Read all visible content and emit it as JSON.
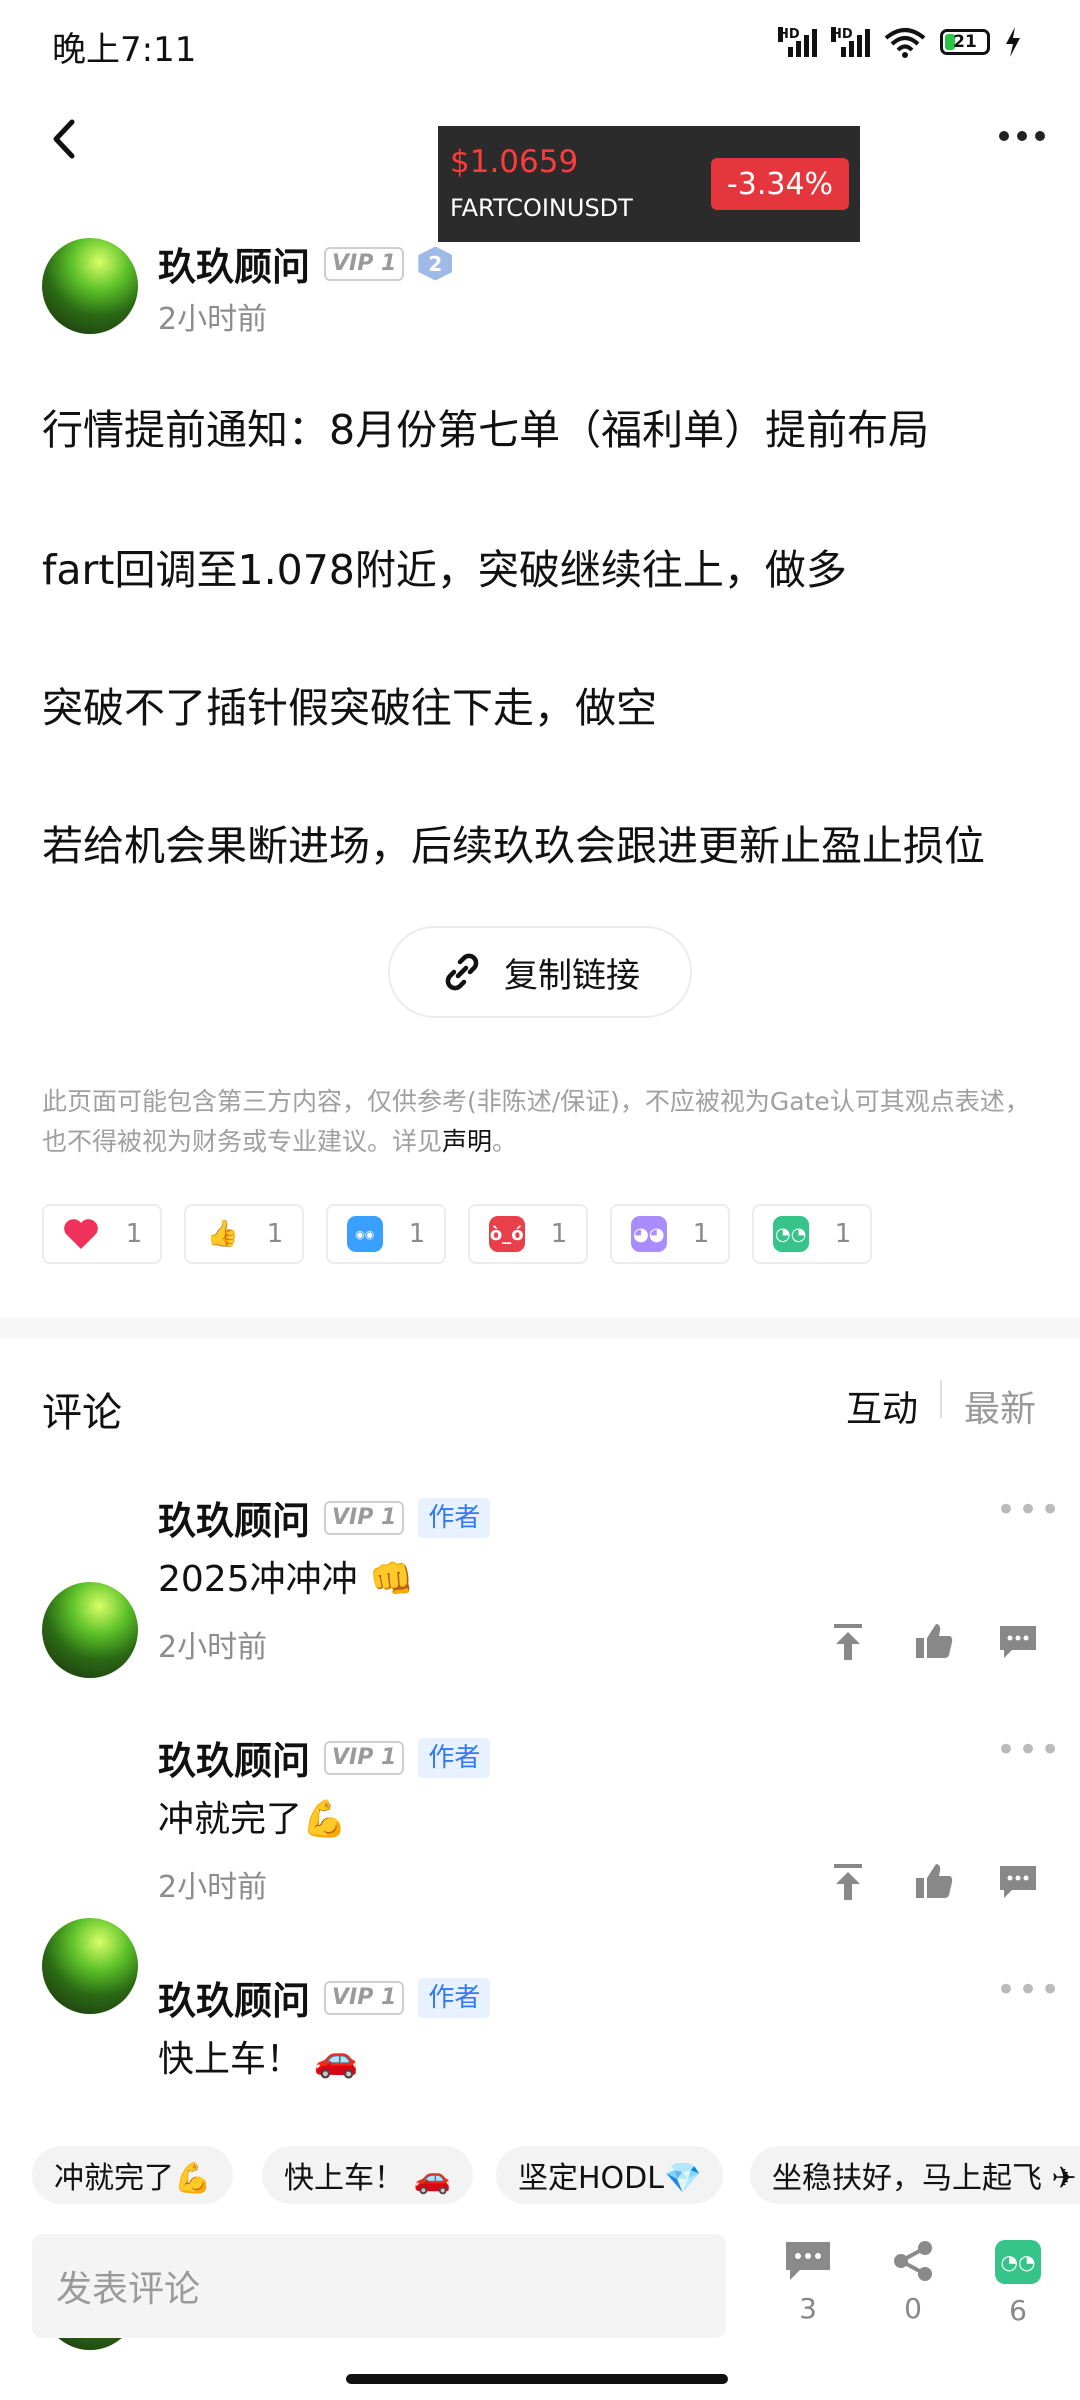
{
  "status": {
    "time": "晚上7:11",
    "battery": "21"
  },
  "ticker": {
    "price": "$1.0659",
    "pair": "FARTCOINUSDT",
    "change": "-3.34%"
  },
  "post": {
    "author": "玖玖顾问",
    "vip": "VIP 1",
    "level": "2",
    "time": "2小时前",
    "lines": [
      "行情提前通知：8月份第七单（福利单）提前布局",
      "fart回调至1.078附近，突破继续往上，做多",
      "突破不了插针假突破往下走，做空",
      "若给机会果断进场，后续玖玖会跟进更新止盈止损位"
    ],
    "copy_link": "复制链接",
    "disclaimer": "此页面可能包含第三方内容，仅供参考(非陈述/保证)，不应被视为Gate认可其观点表述，也不得被视为财务或专业建议。详见",
    "disclaimer_link": "声明",
    "disclaimer_end": "。"
  },
  "reactions": [
    {
      "icon": "heart-icon",
      "count": "1",
      "color": "#f0325a"
    },
    {
      "icon": "thumbs-up-icon",
      "count": "1",
      "color": "#f5b73b"
    },
    {
      "icon": "hodl-icon",
      "count": "1",
      "color": "#3aa0ff"
    },
    {
      "icon": "angry-face-icon",
      "count": "1",
      "color": "#e8404a"
    },
    {
      "icon": "ghost-face-icon",
      "count": "1",
      "color": "#a98cff"
    },
    {
      "icon": "thinking-face-icon",
      "count": "1",
      "color": "#36c48a"
    }
  ],
  "comments_section": {
    "title": "评论",
    "sort_active": "互动",
    "sort_inactive": "最新"
  },
  "comments": [
    {
      "author": "玖玖顾问",
      "vip": "VIP 1",
      "badge": "作者",
      "text": "2025冲冲冲 👊",
      "time": "2小时前"
    },
    {
      "author": "玖玖顾问",
      "vip": "VIP 1",
      "badge": "作者",
      "text": "冲就完了💪",
      "time": "2小时前"
    },
    {
      "author": "玖玖顾问",
      "vip": "VIP 1",
      "badge": "作者",
      "text": "快上车！ 🚗"
    }
  ],
  "quick_replies": [
    "冲就完了💪",
    "快上车！ 🚗",
    "坚定HODL💎",
    "坐稳扶好，马上起飞 ✈"
  ],
  "composer": {
    "placeholder": "发表评论",
    "comments_count": "3",
    "shares_count": "0",
    "reactions_count": "6"
  },
  "colors": {
    "accent_red": "#e5363d",
    "author_badge": "#3478f6",
    "muted": "#8c8c8c"
  }
}
